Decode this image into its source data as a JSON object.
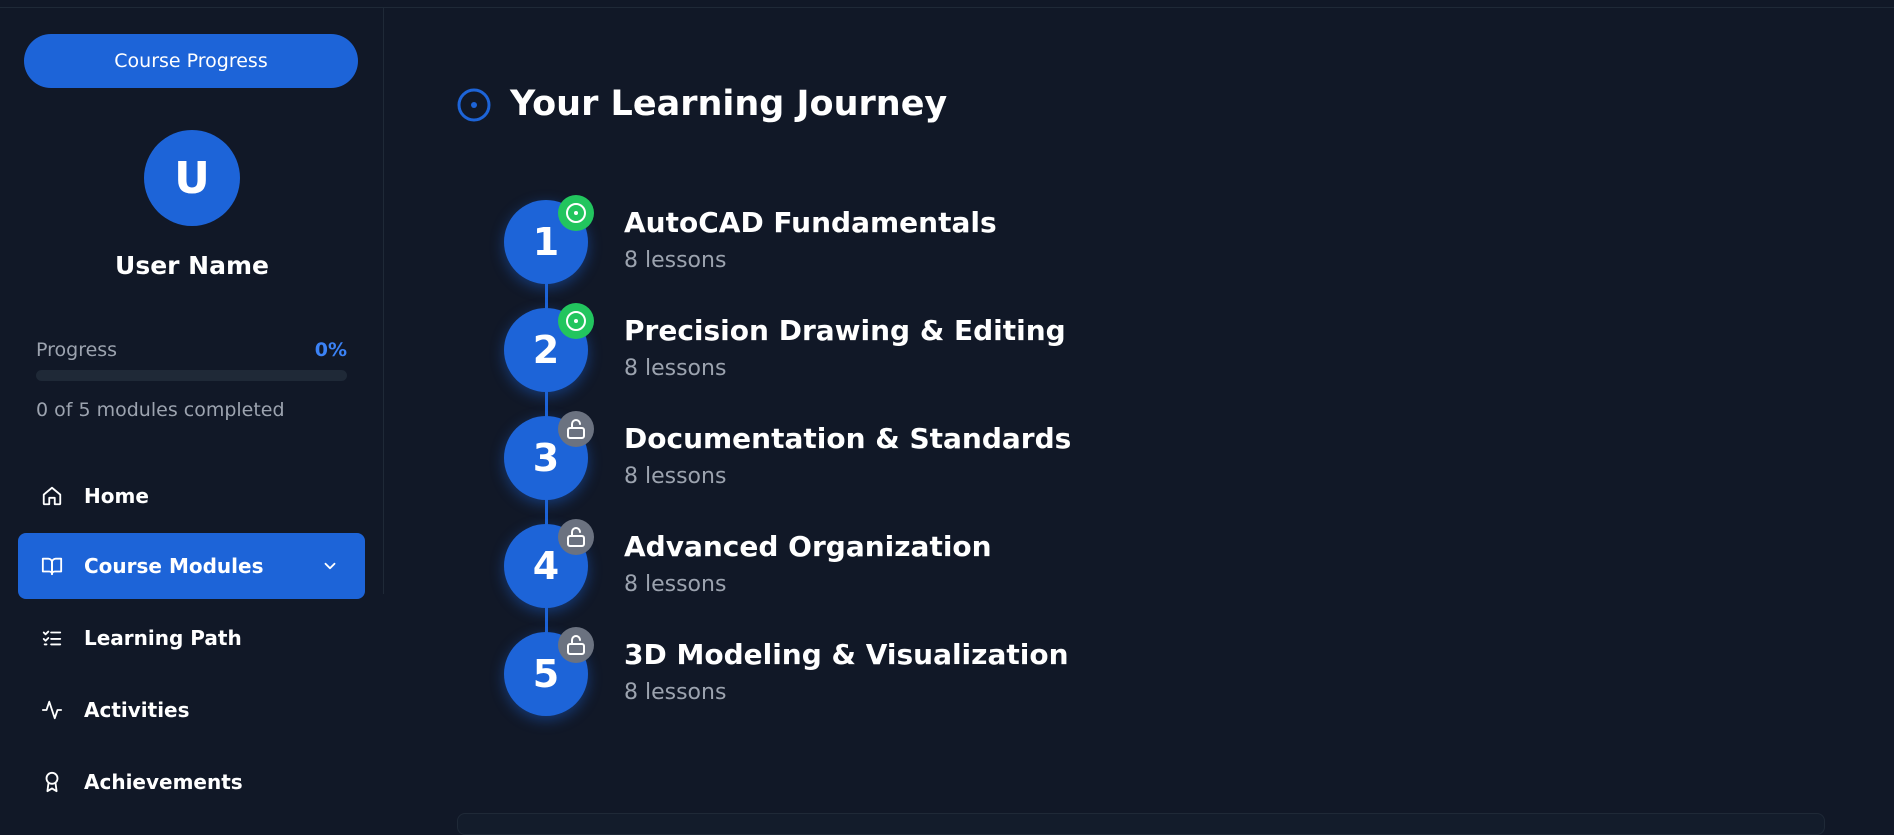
{
  "sidebar": {
    "course_progress_button": "Course Progress",
    "avatar_initial": "U",
    "user_name": "User Name",
    "progress_label": "Progress",
    "progress_percent": "0%",
    "progress_fraction": 0,
    "modules_completed": "0 of 5 modules completed",
    "nav": [
      {
        "label": "Home",
        "icon": "home-icon"
      },
      {
        "label": "Course Modules",
        "icon": "book-open-icon",
        "active": true
      },
      {
        "label": "Learning Path",
        "icon": "list-checks-icon"
      },
      {
        "label": "Activities",
        "icon": "activity-icon"
      },
      {
        "label": "Achievements",
        "icon": "award-icon"
      }
    ]
  },
  "main": {
    "title": "Your Learning Journey",
    "modules": [
      {
        "number": "1",
        "title": "AutoCAD Fundamentals",
        "lessons": "8 lessons",
        "status": "unlocked"
      },
      {
        "number": "2",
        "title": "Precision Drawing & Editing",
        "lessons": "8 lessons",
        "status": "unlocked"
      },
      {
        "number": "3",
        "title": "Documentation & Standards",
        "lessons": "8 lessons",
        "status": "locked"
      },
      {
        "number": "4",
        "title": "Advanced Organization",
        "lessons": "8 lessons",
        "status": "locked"
      },
      {
        "number": "5",
        "title": "3D Modeling & Visualization",
        "lessons": "8 lessons",
        "status": "locked"
      }
    ]
  },
  "colors": {
    "background": "#111827",
    "accent": "#1d64d8",
    "accent_text": "#3b82f6",
    "completed": "#22c55e",
    "locked": "#6b7280",
    "muted_text": "#9ca3af"
  }
}
